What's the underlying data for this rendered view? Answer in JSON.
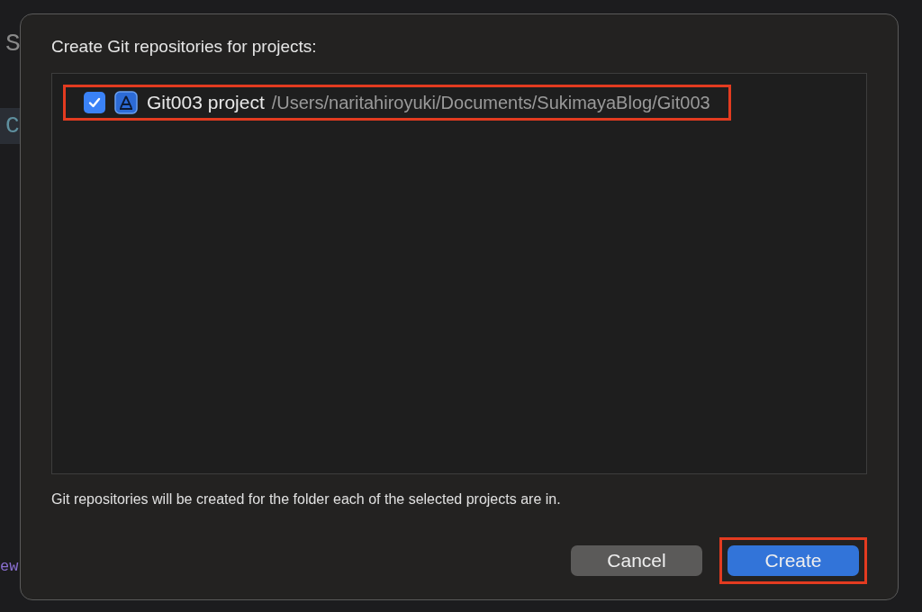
{
  "editor_background": {
    "lines": [
      {
        "text": "S",
        "kind": "heading"
      },
      {
        "text": "C",
        "kind": "current"
      },
      {
        "text": "ew",
        "kind": "keyword"
      }
    ]
  },
  "dialog": {
    "title": "Create Git repositories for projects:",
    "projects": [
      {
        "name": "Git003 project",
        "path": "/Users/naritahiroyuki/Documents/SukimayaBlog/Git003",
        "checked": true,
        "highlighted": true
      }
    ],
    "note": "Git repositories will be created for the folder each of the selected projects are in.",
    "buttons": [
      {
        "label": "Cancel",
        "kind": "secondary",
        "highlighted": false
      },
      {
        "label": "Create",
        "kind": "primary",
        "highlighted": true
      }
    ]
  }
}
